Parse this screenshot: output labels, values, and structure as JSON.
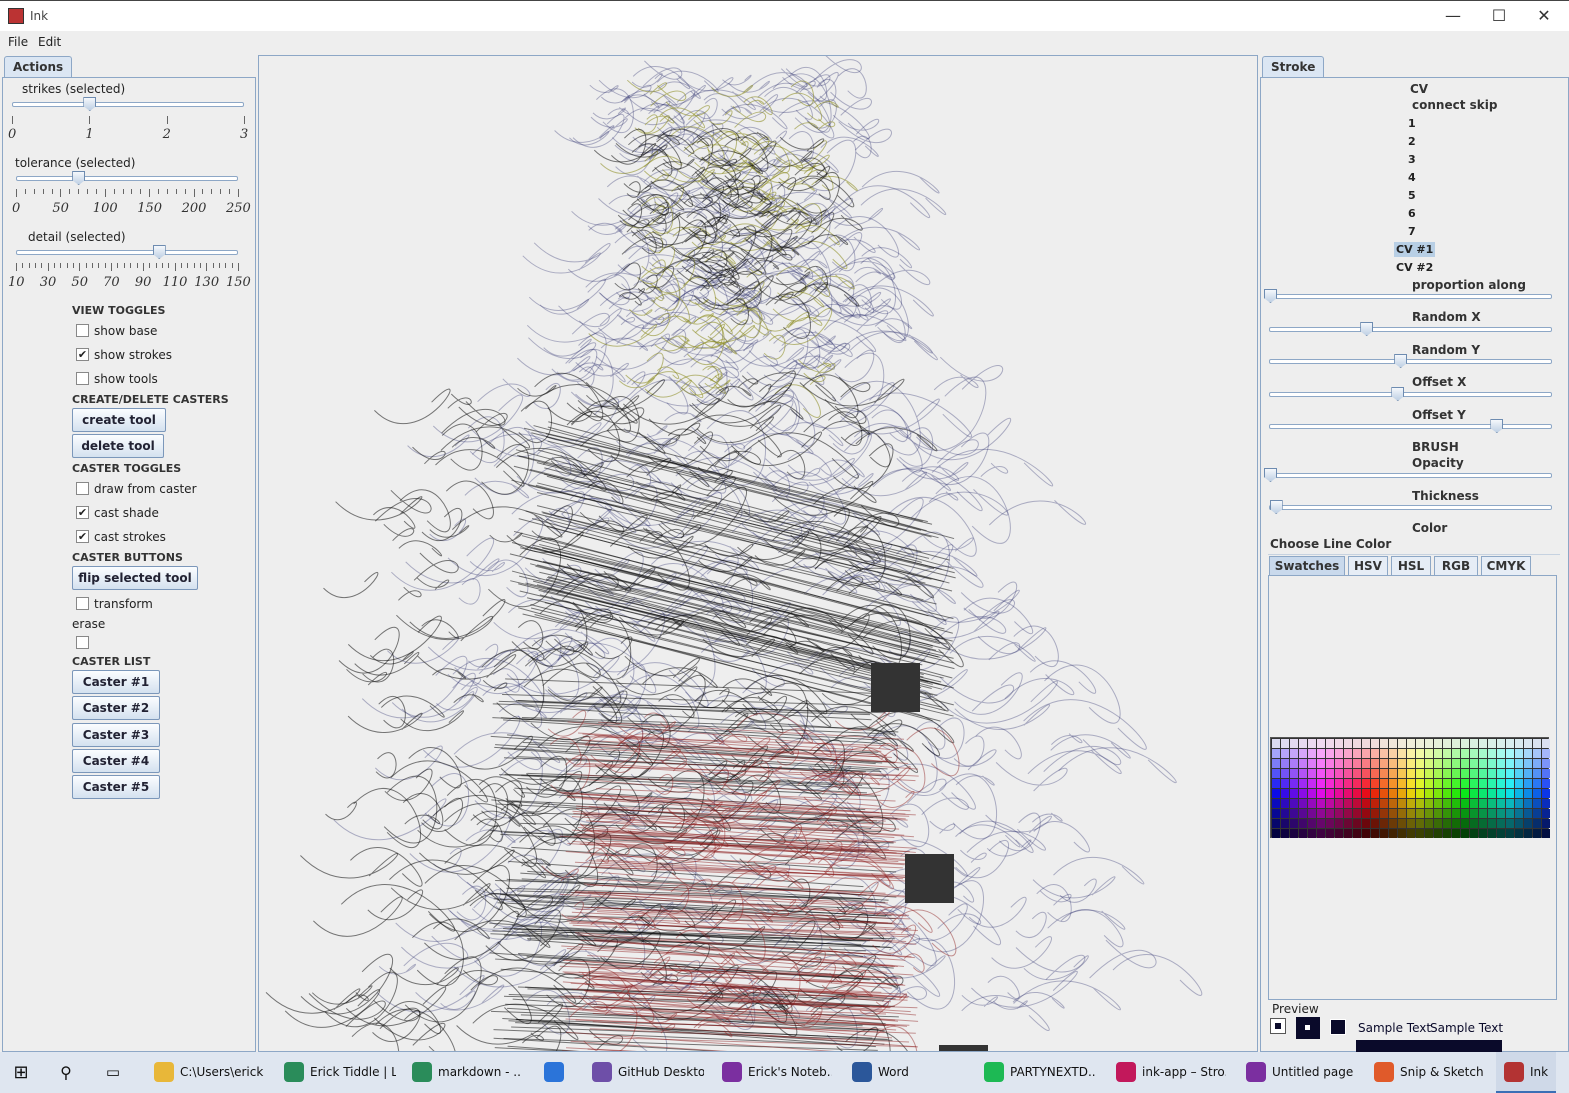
{
  "window": {
    "title": "Ink",
    "minimize": "—",
    "maximize": "☐",
    "close": "✕"
  },
  "menu": {
    "file": "File",
    "edit": "Edit"
  },
  "left": {
    "tab": "Actions",
    "strikes": {
      "label": "strikes (selected)",
      "ticks": [
        "0",
        "1",
        "2",
        "3"
      ],
      "value": 1
    },
    "tolerance": {
      "label": "tolerance (selected)",
      "ticks": [
        "0",
        "50",
        "100",
        "150",
        "200",
        "250"
      ],
      "value": 70
    },
    "detail": {
      "label": "detail (selected)",
      "ticks": [
        "10",
        "30",
        "50",
        "70",
        "90",
        "110",
        "130",
        "150"
      ],
      "value": 100
    },
    "view_toggles": "VIEW TOGGLES",
    "show_base": {
      "label": "show base",
      "checked": false
    },
    "show_strokes": {
      "label": "show strokes",
      "checked": true
    },
    "show_tools": {
      "label": "show tools",
      "checked": false
    },
    "create_delete": "CREATE/DELETE CASTERS",
    "create_tool": "create tool",
    "delete_tool": "delete tool",
    "caster_toggles": "CASTER TOGGLES",
    "draw_from_caster": {
      "label": "draw from caster",
      "checked": false
    },
    "cast_shade": {
      "label": "cast shade",
      "checked": true
    },
    "cast_strokes": {
      "label": "cast strokes",
      "checked": true
    },
    "caster_buttons": "CASTER BUTTONS",
    "flip_selected_tool": "flip selected tool",
    "transform": {
      "label": "transform",
      "checked": false
    },
    "erase": {
      "label": "erase",
      "checked": false
    },
    "caster_list": "CASTER LIST",
    "casters": [
      "Caster #1",
      "Caster #2",
      "Caster #3",
      "Caster #4",
      "Caster #5"
    ]
  },
  "right": {
    "tab": "Stroke",
    "cv": "CV",
    "connect_skip": "connect skip",
    "numbers": [
      "1",
      "2",
      "3",
      "4",
      "5",
      "6",
      "7"
    ],
    "cv_items": [
      "CV #1",
      "CV #2"
    ],
    "selected_cv": "CV #1",
    "proportion_along": {
      "label": "proportion along",
      "value": 0.0
    },
    "random_x": {
      "label": "Random X",
      "value": 0.34
    },
    "random_y": {
      "label": "Random Y",
      "value": 0.46
    },
    "offset_x": {
      "label": "Offset X",
      "value": 0.45
    },
    "offset_y": {
      "label": "Offset Y",
      "value": 0.8
    },
    "brush": "BRUSH",
    "opacity": {
      "label": "Opacity",
      "value": 0.0
    },
    "thickness": {
      "label": "Thickness",
      "value": 0.02
    },
    "color": "Color",
    "choose_line_color": "Choose Line Color",
    "color_tabs": [
      "Swatches",
      "HSV",
      "HSL",
      "RGB",
      "CMYK"
    ],
    "active_color_tab": "Swatches",
    "preview": "Preview",
    "sample_text_1": "Sample Text",
    "sample_text_2": "Sample Text"
  },
  "taskbar": {
    "items": [
      {
        "label": "C:\\Users\\erick...",
        "icon": "folder-icon",
        "color": "#e8b739"
      },
      {
        "label": "Erick Tiddle | L...",
        "icon": "edge-dev-icon",
        "color": "#2a8c5a"
      },
      {
        "label": "markdown - ...",
        "icon": "edge-dev-icon",
        "color": "#2a8c5a"
      },
      {
        "label": "",
        "icon": "todo-check-icon",
        "color": "#2b74d9"
      },
      {
        "label": "GitHub Desktop",
        "icon": "github-desktop-icon",
        "color": "#6e4fa8"
      },
      {
        "label": "Erick's Noteb...",
        "icon": "onenote-icon",
        "color": "#7b2fa0"
      },
      {
        "label": "Word",
        "icon": "word-icon",
        "color": "#2b579a"
      },
      {
        "label": "PARTYNEXTD...",
        "icon": "spotify-icon",
        "color": "#1db954"
      },
      {
        "label": "ink-app – Stro...",
        "icon": "intellij-icon",
        "color": "#c2185b"
      },
      {
        "label": "Untitled page ...",
        "icon": "onenote-icon",
        "color": "#7b2fa0"
      },
      {
        "label": "Snip & Sketch",
        "icon": "snip-sketch-icon",
        "color": "#e05a2a"
      },
      {
        "label": "Ink",
        "icon": "ink-app-icon",
        "color": "#b33333"
      }
    ]
  },
  "colors": {
    "accent": "#8da7c6",
    "stroke_blue": "#2a2d6e",
    "stroke_olive": "#8a8a1e",
    "stroke_red": "#8b1a1a"
  }
}
